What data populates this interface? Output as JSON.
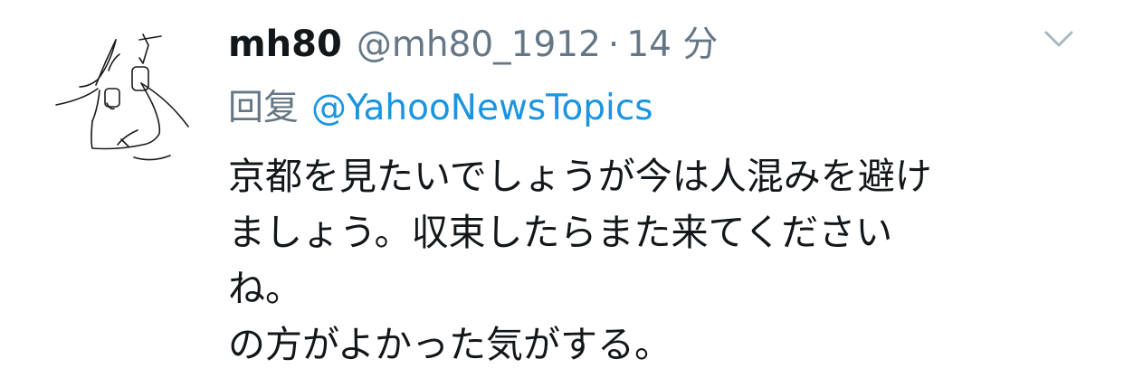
{
  "tweet": {
    "display_name": "mh80",
    "handle": "@mh80_1912",
    "separator": "·",
    "time": "14 分",
    "reply_label": "回复",
    "reply_to": "@YahooNewsTopics",
    "body_lines": [
      "京都を見たいでしょうが今は人混みを避け",
      "ましょう。収束したらまた来てくださいね。",
      "の方がよかった気がする。"
    ],
    "caret_icon": "chevron-down-icon"
  },
  "colors": {
    "text_primary": "#14171a",
    "text_secondary": "#657786",
    "link": "#1b95e0"
  }
}
